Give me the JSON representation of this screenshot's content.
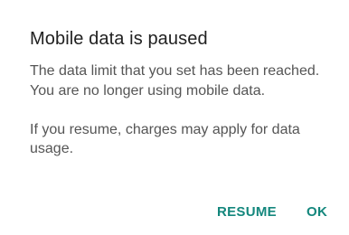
{
  "dialog": {
    "title": "Mobile data is paused",
    "message_1": "The data limit that you set has been reached. You are no longer using mobile data.",
    "message_2": "If you resume, charges may apply for data usage.",
    "buttons": {
      "resume_label": "RESUME",
      "ok_label": "OK"
    }
  },
  "colors": {
    "accent": "#14877d",
    "title_text": "#212121",
    "body_text": "#555555",
    "background": "#ffffff"
  }
}
